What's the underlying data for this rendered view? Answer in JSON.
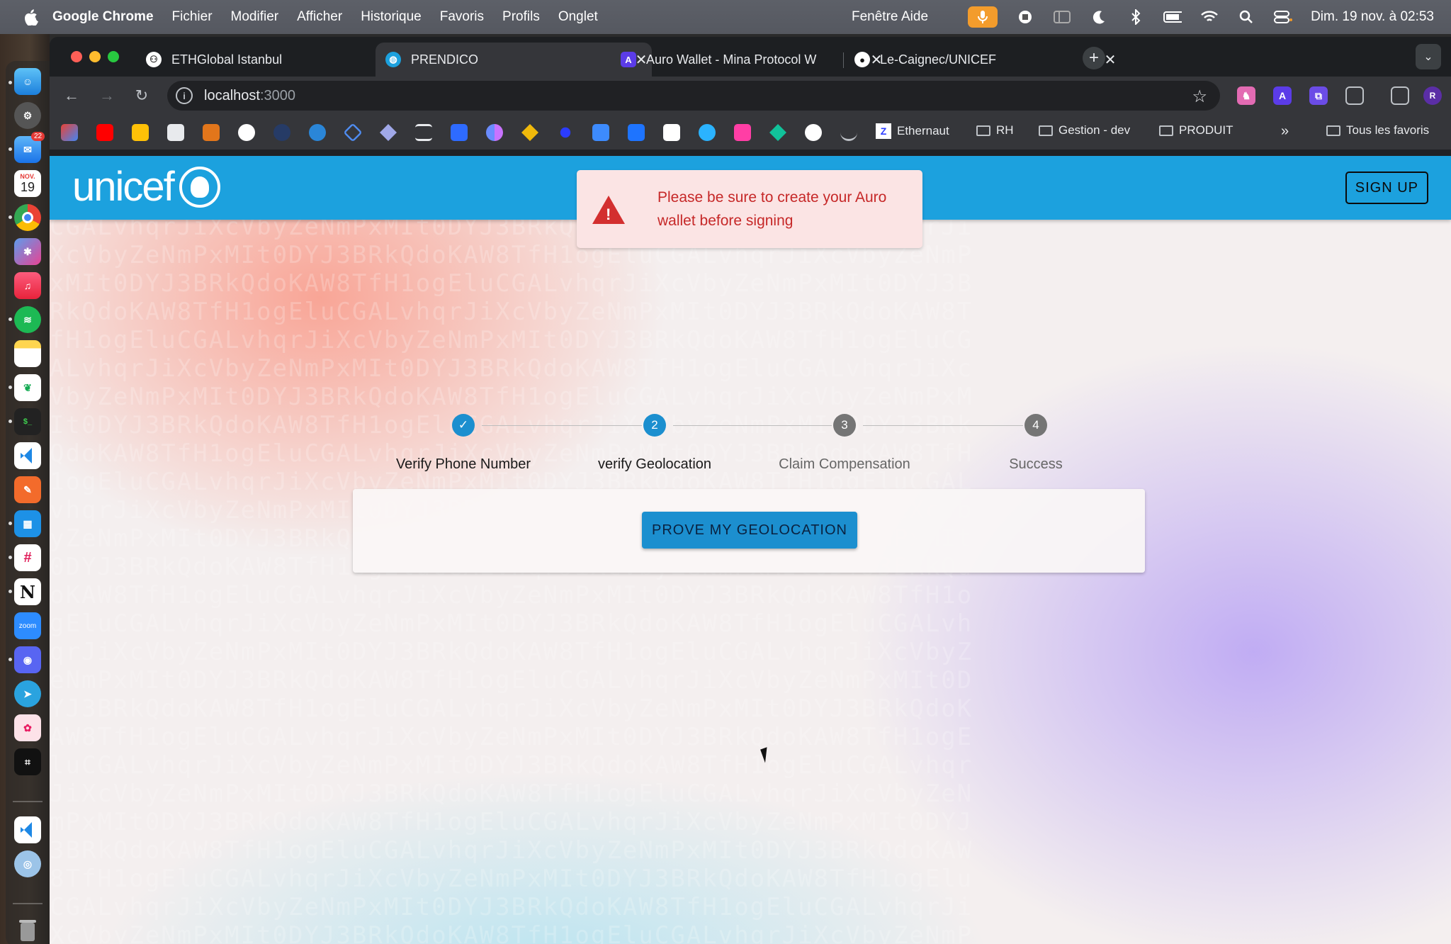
{
  "menubar": {
    "app_name": "Google Chrome",
    "items": [
      "Fichier",
      "Modifier",
      "Afficher",
      "Historique",
      "Favoris",
      "Profils",
      "Onglet"
    ],
    "right_items": [
      "Fenêtre",
      "Aide"
    ],
    "clock": "Dim. 19 nov. à 02:53"
  },
  "dock": {
    "calendar_month": "NOV.",
    "calendar_day": "19",
    "mail_badge": "22",
    "zoom_label": "zoom"
  },
  "tabs": [
    {
      "title": "ETHGlobal Istanbul",
      "active": false
    },
    {
      "title": "PRENDICO",
      "active": true
    },
    {
      "title": "Auro Wallet - Mina Protocol W",
      "active": false
    },
    {
      "title": "Le-Caignec/UNICEF",
      "active": false
    }
  ],
  "address_bar": {
    "host": "localhost",
    "port": ":3000"
  },
  "bookmarks": {
    "ethernaut": "Ethernaut",
    "folders": [
      "RH",
      "Gestion - dev",
      "PRODUIT"
    ],
    "all_favorites": "Tous les favoris"
  },
  "appbar": {
    "logo_text": "unicef",
    "signup_label": "SIGN UP",
    "brand_color": "#1ca1de"
  },
  "alert": {
    "message": "Please be sure to create your Auro wallet before signing",
    "severity_color": "#d32f2f"
  },
  "stepper": {
    "steps": [
      {
        "label": "Verify Phone Number",
        "status": "completed",
        "number": "✓"
      },
      {
        "label": "verify Geolocation",
        "status": "active",
        "number": "2"
      },
      {
        "label": "Claim Compensation",
        "status": "pending",
        "number": "3"
      },
      {
        "label": "Success",
        "status": "pending",
        "number": "4"
      }
    ],
    "active_color": "#1c8fcf",
    "pending_color": "#757575"
  },
  "main": {
    "prove_button_label": "PROVE MY GEOLOCATION"
  }
}
